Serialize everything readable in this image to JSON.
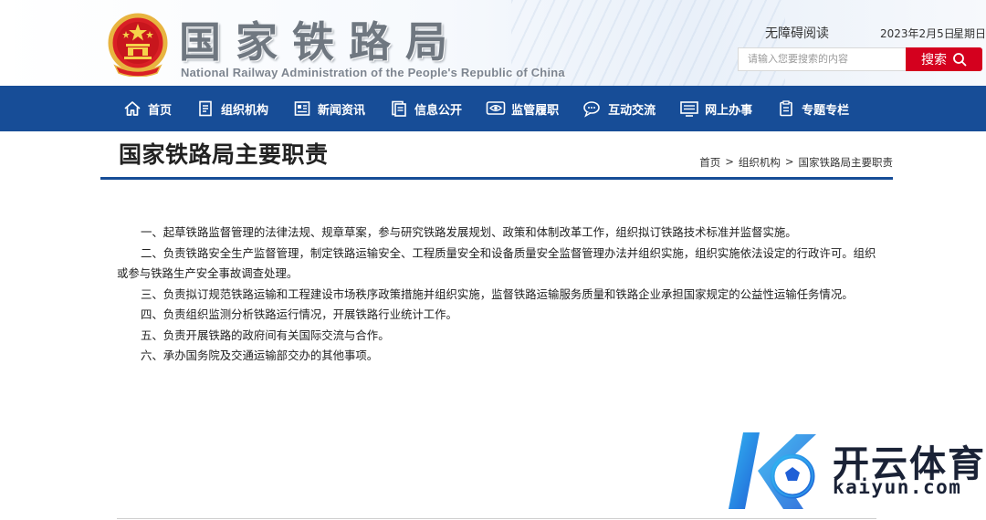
{
  "header": {
    "site_title": "国家铁路局",
    "site_subtitle": "National Railway Administration of the People's Republic of China",
    "accessible_label": "无障碍阅读",
    "date": "2023年2月5日",
    "weekday": "星期日",
    "search": {
      "placeholder": "请输入您要搜索的内容",
      "value": "",
      "button_label": "搜索"
    }
  },
  "nav": {
    "items": [
      {
        "label": "首页",
        "icon": "home-icon"
      },
      {
        "label": "组织机构",
        "icon": "org-document-icon"
      },
      {
        "label": "新闻资讯",
        "icon": "news-icon"
      },
      {
        "label": "信息公开",
        "icon": "info-open-icon"
      },
      {
        "label": "监管履职",
        "icon": "eye-icon"
      },
      {
        "label": "互动交流",
        "icon": "chat-icon"
      },
      {
        "label": "网上办事",
        "icon": "online-service-icon"
      },
      {
        "label": "专题专栏",
        "icon": "clipboard-icon"
      }
    ]
  },
  "page": {
    "title": "国家铁路局主要职责",
    "breadcrumb": [
      "首页",
      "组织机构",
      "国家铁路局主要职责"
    ],
    "breadcrumb_separator": ">",
    "paragraphs": [
      "一、起草铁路监督管理的法律法规、规章草案，参与研究铁路发展规划、政策和体制改革工作，组织拟订铁路技术标准并监督实施。",
      "二、负责铁路安全生产监督管理，制定铁路运输安全、工程质量安全和设备质量安全监督管理办法并组织实施，组织实施依法设定的行政许可。组织或参与铁路生产安全事故调查处理。",
      "三、负责拟订规范铁路运输和工程建设市场秩序政策措施并组织实施，监督铁路运输服务质量和铁路企业承担国家规定的公益性运输任务情况。",
      "四、负责组织监测分析铁路运行情况，开展铁路行业统计工作。",
      "五、负责开展铁路的政府间有关国际交流与合作。",
      "六、承办国务院及交通运输部交办的其他事项。"
    ]
  },
  "watermark": {
    "brand_text": "开云体育",
    "url_text": "kaiyun.com",
    "icon": "k-soccer-logo-icon"
  },
  "colors": {
    "nav_bg": "#174d97",
    "search_button": "#d4001e",
    "title_rule": "#174d97"
  }
}
